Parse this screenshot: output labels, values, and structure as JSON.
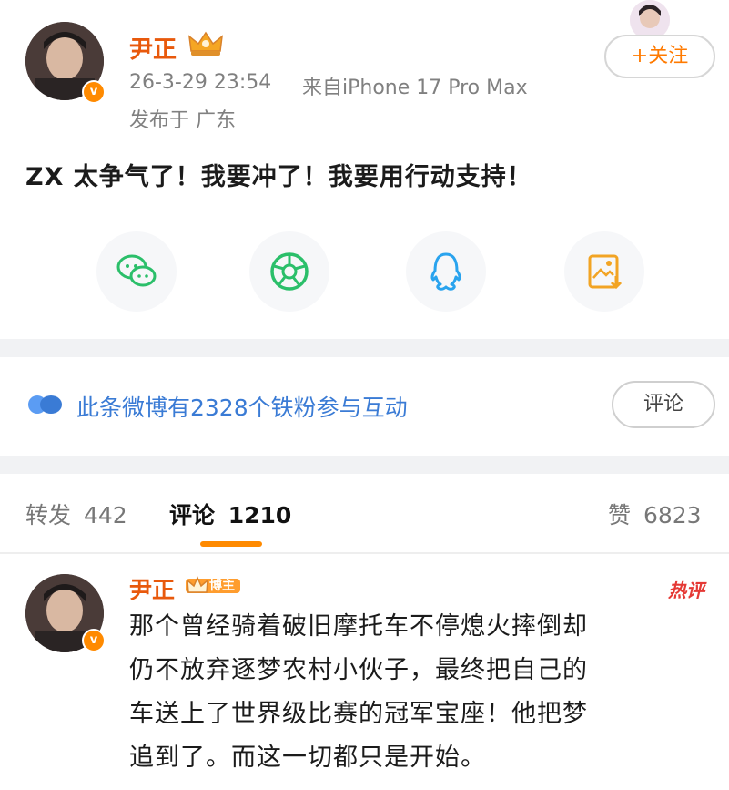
{
  "post": {
    "author": "尹正",
    "verified_mark": "v",
    "timestamp": "26-3-29 23:54",
    "source": "来自iPhone 17 Pro Max",
    "location": "发布于 广东",
    "content": "ZX 太争气了！我要冲了！我要用行动支持！",
    "follow_label": "+关注"
  },
  "share": {
    "icons": [
      "wechat-icon",
      "moments-icon",
      "qq-icon",
      "save-image-icon"
    ],
    "colors": {
      "wechat": "#2bbf6a",
      "moments": "#2bbf6a",
      "qq": "#29a3ee",
      "save": "#f2a424"
    }
  },
  "fans_bar": {
    "text": "此条微博有2328个铁粉参与互动",
    "comment_label": "评论"
  },
  "tabs": {
    "repost_label": "转发",
    "repost_count": "442",
    "comment_label": "评论",
    "comment_count": "1210",
    "like_label": "赞",
    "like_count": "6823"
  },
  "comment": {
    "author": "尹正",
    "badge": "博主",
    "hot_tag": "热评",
    "lines": [
      "那个曾经骑着破旧摩托车不停熄火摔倒却",
      "仍不放弃逐梦农村小伙子，最终把自己的",
      "车送上了世界级比赛的冠军宝座！他把梦",
      "追到了。而这一切都只是开始。"
    ]
  },
  "accent": "#ff8a00"
}
